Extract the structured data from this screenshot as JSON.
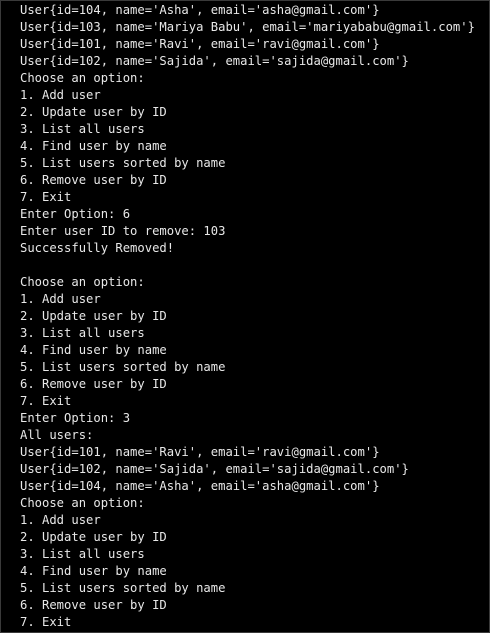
{
  "console": {
    "lines": [
      "User{id=104, name='Asha', email='asha@gmail.com'}",
      "User{id=103, name='Mariya Babu', email='mariyababu@gmail.com'}",
      "User{id=101, name='Ravi', email='ravi@gmail.com'}",
      "User{id=102, name='Sajida', email='sajida@gmail.com'}",
      "Choose an option:",
      "1. Add user",
      "2. Update user by ID",
      "3. List all users",
      "4. Find user by name",
      "5. List users sorted by name",
      "6. Remove user by ID",
      "7. Exit",
      "Enter Option: 6",
      "Enter user ID to remove: 103",
      "Successfully Removed!",
      "",
      "Choose an option:",
      "1. Add user",
      "2. Update user by ID",
      "3. List all users",
      "4. Find user by name",
      "5. List users sorted by name",
      "6. Remove user by ID",
      "7. Exit",
      "Enter Option: 3",
      "All users:",
      "User{id=101, name='Ravi', email='ravi@gmail.com'}",
      "User{id=102, name='Sajida', email='sajida@gmail.com'}",
      "User{id=104, name='Asha', email='asha@gmail.com'}",
      "Choose an option:",
      "1. Add user",
      "2. Update user by ID",
      "3. List all users",
      "4. Find user by name",
      "5. List users sorted by name",
      "6. Remove user by ID",
      "7. Exit"
    ]
  },
  "colors": {
    "background": "#000000",
    "text": "#e8e8e8"
  }
}
